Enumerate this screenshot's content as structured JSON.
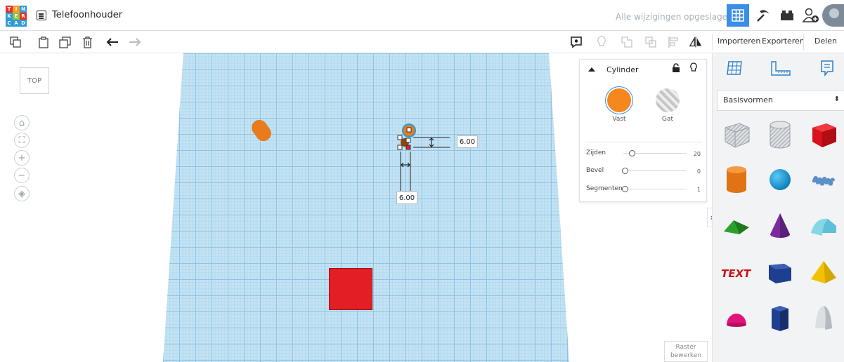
{
  "app": {
    "logo_letters": [
      "T",
      "I",
      "N",
      "K",
      "E",
      "R",
      "C",
      "A",
      "D"
    ],
    "document_title": "Telefoonhouder",
    "save_status": "Alle wijzigingen opgeslagen"
  },
  "toolbar": {
    "import_label": "Importeren",
    "export_label": "Exporteren",
    "share_label": "Delen"
  },
  "viewcube": {
    "face_label": "TOP"
  },
  "dimensions": {
    "height_value": "6.00",
    "width_value": "6.00"
  },
  "inspector": {
    "shape_name": "Cylinder",
    "solid_label": "Vast",
    "hole_label": "Gat",
    "solid_color": "#f5871f",
    "props": [
      {
        "label": "Zijden",
        "value": "20"
      },
      {
        "label": "Bevel",
        "value": "0"
      },
      {
        "label": "Segmenten",
        "value": "1"
      }
    ]
  },
  "raster": {
    "line1": "Raster",
    "line2": "bewerken"
  },
  "panel": {
    "category": "Basisvormen",
    "shapes": [
      "box-hole",
      "cylinder-hole",
      "box",
      "cylinder",
      "sphere",
      "scribble",
      "roof",
      "cone",
      "round-roof",
      "text",
      "wedge",
      "pyramid",
      "half-sphere",
      "polygon",
      "paraboloid"
    ]
  },
  "colors": {
    "accent": "#3a8ee6",
    "grid": "#c4e3f3",
    "red_box": "#e31e24",
    "orange": "#e87b1d"
  }
}
